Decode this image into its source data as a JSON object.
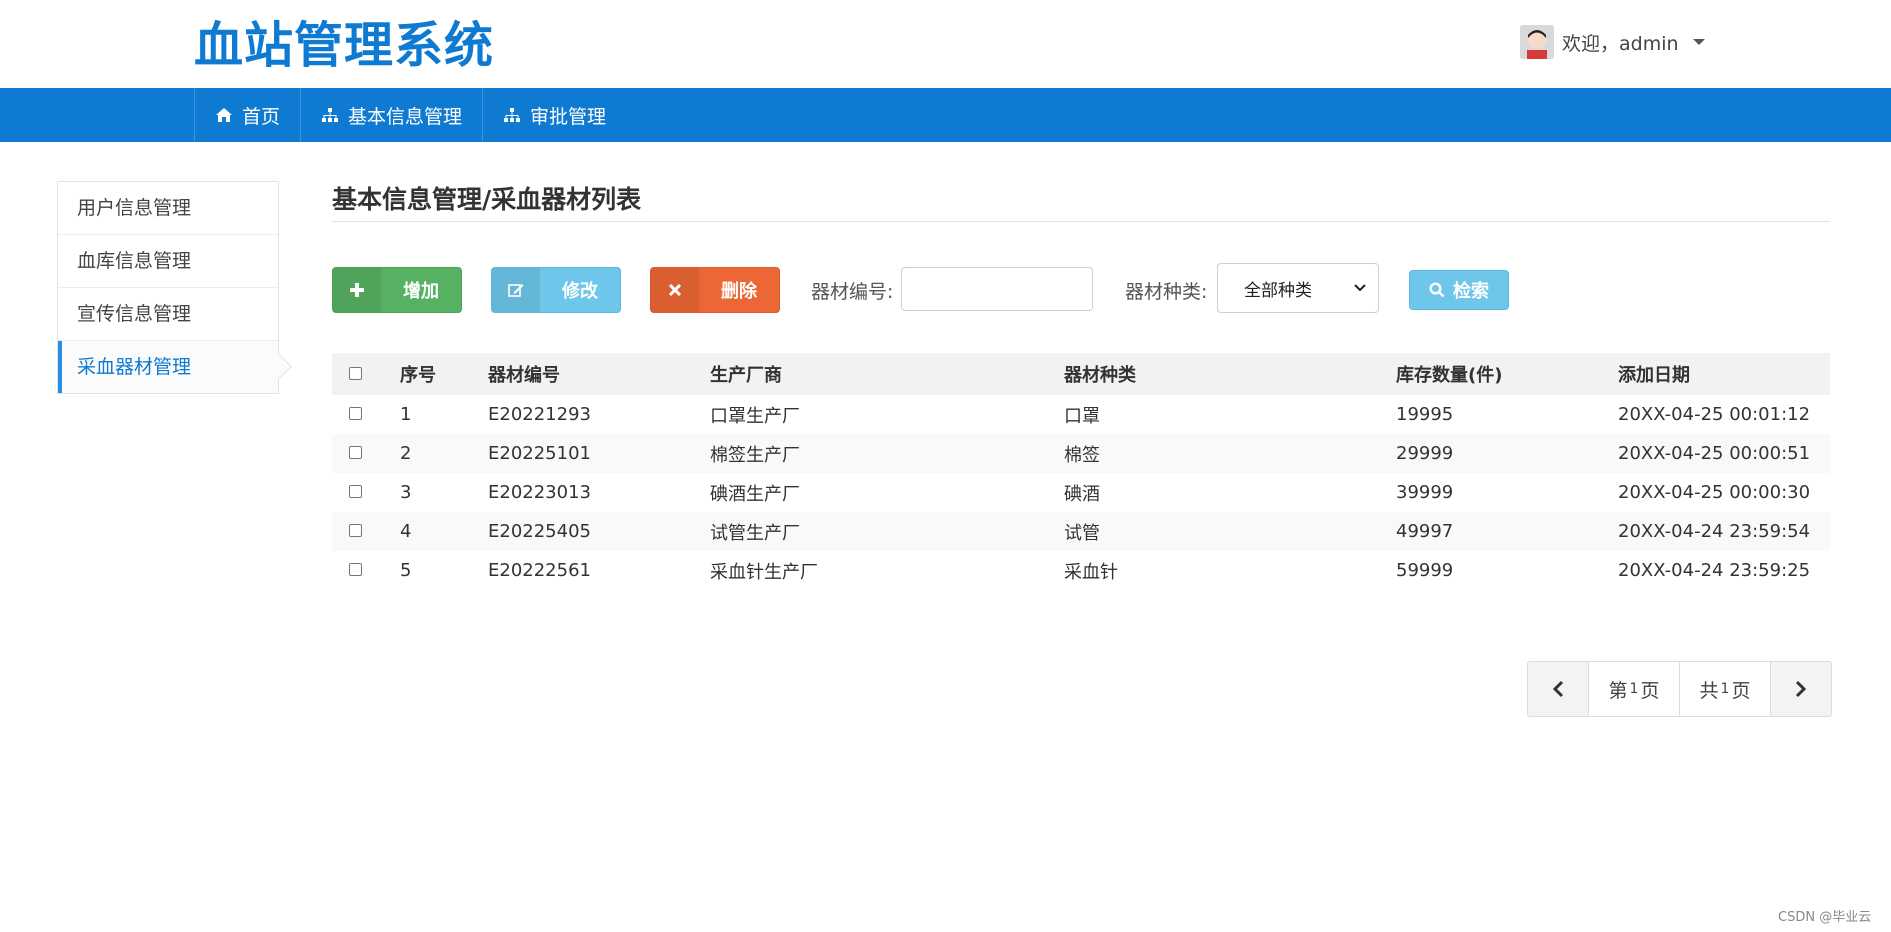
{
  "header": {
    "logo": "血站管理系统",
    "welcome": "欢迎，admin"
  },
  "nav": [
    {
      "label": "首页",
      "icon": "home-icon"
    },
    {
      "label": "基本信息管理",
      "icon": "sitemap-icon"
    },
    {
      "label": "审批管理",
      "icon": "sitemap-icon"
    }
  ],
  "sidebar": [
    {
      "label": "用户信息管理"
    },
    {
      "label": "血库信息管理"
    },
    {
      "label": "宣传信息管理"
    },
    {
      "label": "采血器材管理",
      "active": true
    }
  ],
  "page": {
    "title": "基本信息管理/采血器材列表"
  },
  "toolbar": {
    "add_label": "增加",
    "edit_label": "修改",
    "delete_label": "删除",
    "code_label": "器材编号:",
    "code_value": "",
    "type_label": "器材种类:",
    "type_selected": "全部种类",
    "search_label": "检索"
  },
  "table": {
    "headers": [
      "序号",
      "器材编号",
      "生产厂商",
      "器材种类",
      "库存数量(件)",
      "添加日期"
    ],
    "rows": [
      [
        "1",
        "E20221293",
        "口罩生产厂",
        "口罩",
        "19995",
        "20XX-04-25 00:01:12"
      ],
      [
        "2",
        "E20225101",
        "棉签生产厂",
        "棉签",
        "29999",
        "20XX-04-25 00:00:51"
      ],
      [
        "3",
        "E20223013",
        "碘酒生产厂",
        "碘酒",
        "39999",
        "20XX-04-25 00:00:30"
      ],
      [
        "4",
        "E20225405",
        "试管生产厂",
        "试管",
        "49997",
        "20XX-04-24 23:59:54"
      ],
      [
        "5",
        "E20222561",
        "采血针生产厂",
        "采血针",
        "59999",
        "20XX-04-24 23:59:25"
      ]
    ]
  },
  "pager": {
    "page_prefix": "第",
    "page_num": "1",
    "page_suffix": "页",
    "total_prefix": "共",
    "total_num": "1",
    "total_suffix": " 页"
  },
  "watermark": "CSDN @毕业云",
  "colors": {
    "brand": "#0f7ad2",
    "add": "#56b163",
    "edit": "#6ec7ea",
    "delete": "#ec6735"
  }
}
